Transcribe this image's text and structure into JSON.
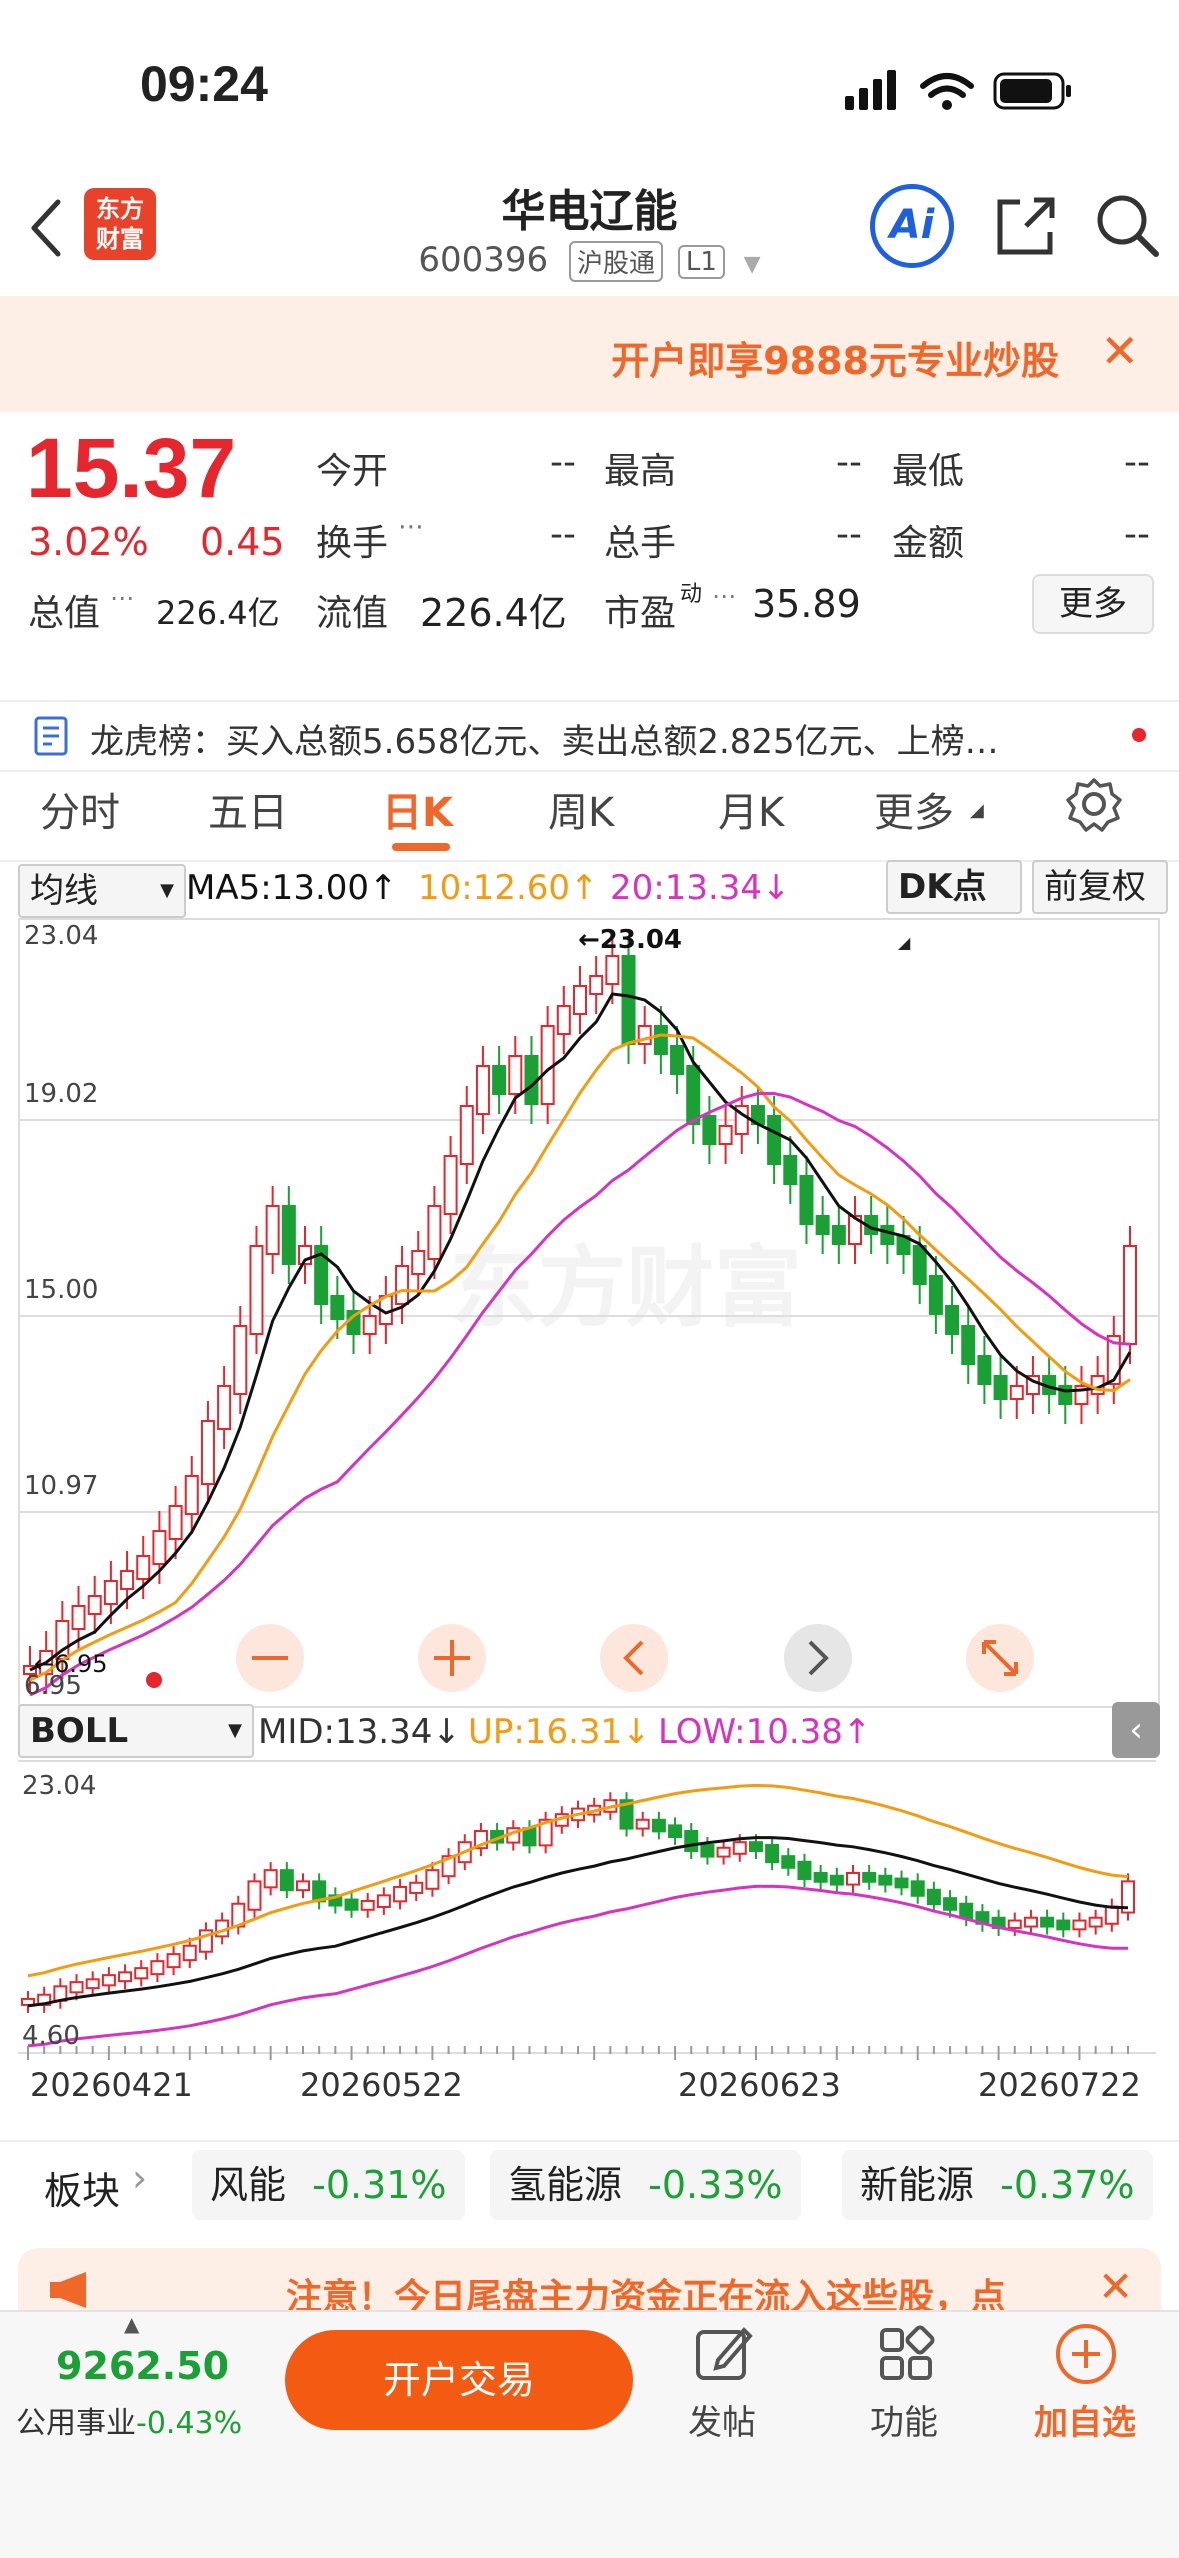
{
  "status": {
    "time": "09:24"
  },
  "header": {
    "logo_text_1": "东方",
    "logo_text_2": "财富",
    "title": "华电辽能",
    "code": "600396",
    "tag1": "沪股通",
    "tag2": "L1",
    "ai_label": "Ai"
  },
  "promo": {
    "text": "开户即享9888元专业炒股"
  },
  "quote": {
    "price": "15.37",
    "pct": "3.02%",
    "change": "0.45",
    "fields": [
      {
        "label": "今开",
        "value": "--"
      },
      {
        "label": "最高",
        "value": "--"
      },
      {
        "label": "最低",
        "value": "--"
      },
      {
        "label": "换手",
        "value": "--"
      },
      {
        "label": "总手",
        "value": "--"
      },
      {
        "label": "金额",
        "value": "--"
      }
    ],
    "total_value_label": "总值",
    "total_value": "226.4亿",
    "float_value_label": "流值",
    "float_value": "226.4亿",
    "pe_label": "市盈",
    "pe_sup": "动",
    "pe_value": "35.89",
    "more_label": "更多"
  },
  "news": {
    "text": "龙虎榜：买入总额5.658亿元、卖出总额2.825亿元、上榜…"
  },
  "tabs": [
    {
      "label": "分时"
    },
    {
      "label": "五日"
    },
    {
      "label": "日K"
    },
    {
      "label": "周K"
    },
    {
      "label": "月K"
    },
    {
      "label": "更多"
    }
  ],
  "ma_row": {
    "selector": "均线",
    "ma5": "MA5:13.00↑",
    "ma10": "10:12.60↑",
    "ma20": "20:13.34↓",
    "dk": "DK点",
    "fq": "前复权"
  },
  "main_chart": {
    "y_labels": [
      "23.04",
      "19.02",
      "15.00",
      "10.97",
      "6.95"
    ],
    "high_marker": "←23.04",
    "low_marker": "←6.95",
    "watermark": "东方财富"
  },
  "boll_row": {
    "selector": "BOLL",
    "mid": "MID:13.34↓",
    "up": "UP:16.31↓",
    "low": "LOW:10.38↑"
  },
  "boll_chart": {
    "y_labels": [
      "23.04",
      "4.60"
    ],
    "dates": [
      "20260421",
      "20260522",
      "20260623",
      "20260722"
    ]
  },
  "colors": {
    "up": "#e5262d",
    "down": "#1aa035",
    "ma5": "#111111",
    "ma10": "#f39c12",
    "ma20": "#d633c0",
    "accent": "#f0672a"
  },
  "sectors": {
    "label": "板块",
    "items": [
      {
        "name": "风能",
        "pct": "-0.31%"
      },
      {
        "name": "氢能源",
        "pct": "-0.33%"
      },
      {
        "name": "新能源",
        "pct": "-0.37%"
      }
    ]
  },
  "notice": {
    "text": "注意！今日尾盘主力资金正在流入这些股，点"
  },
  "bottom": {
    "index_value": "9262.50",
    "index_name": "公用事业",
    "index_pct": "-0.43%",
    "open_trade": "开户交易",
    "post": "发帖",
    "func": "功能",
    "add_fav": "加自选"
  }
}
